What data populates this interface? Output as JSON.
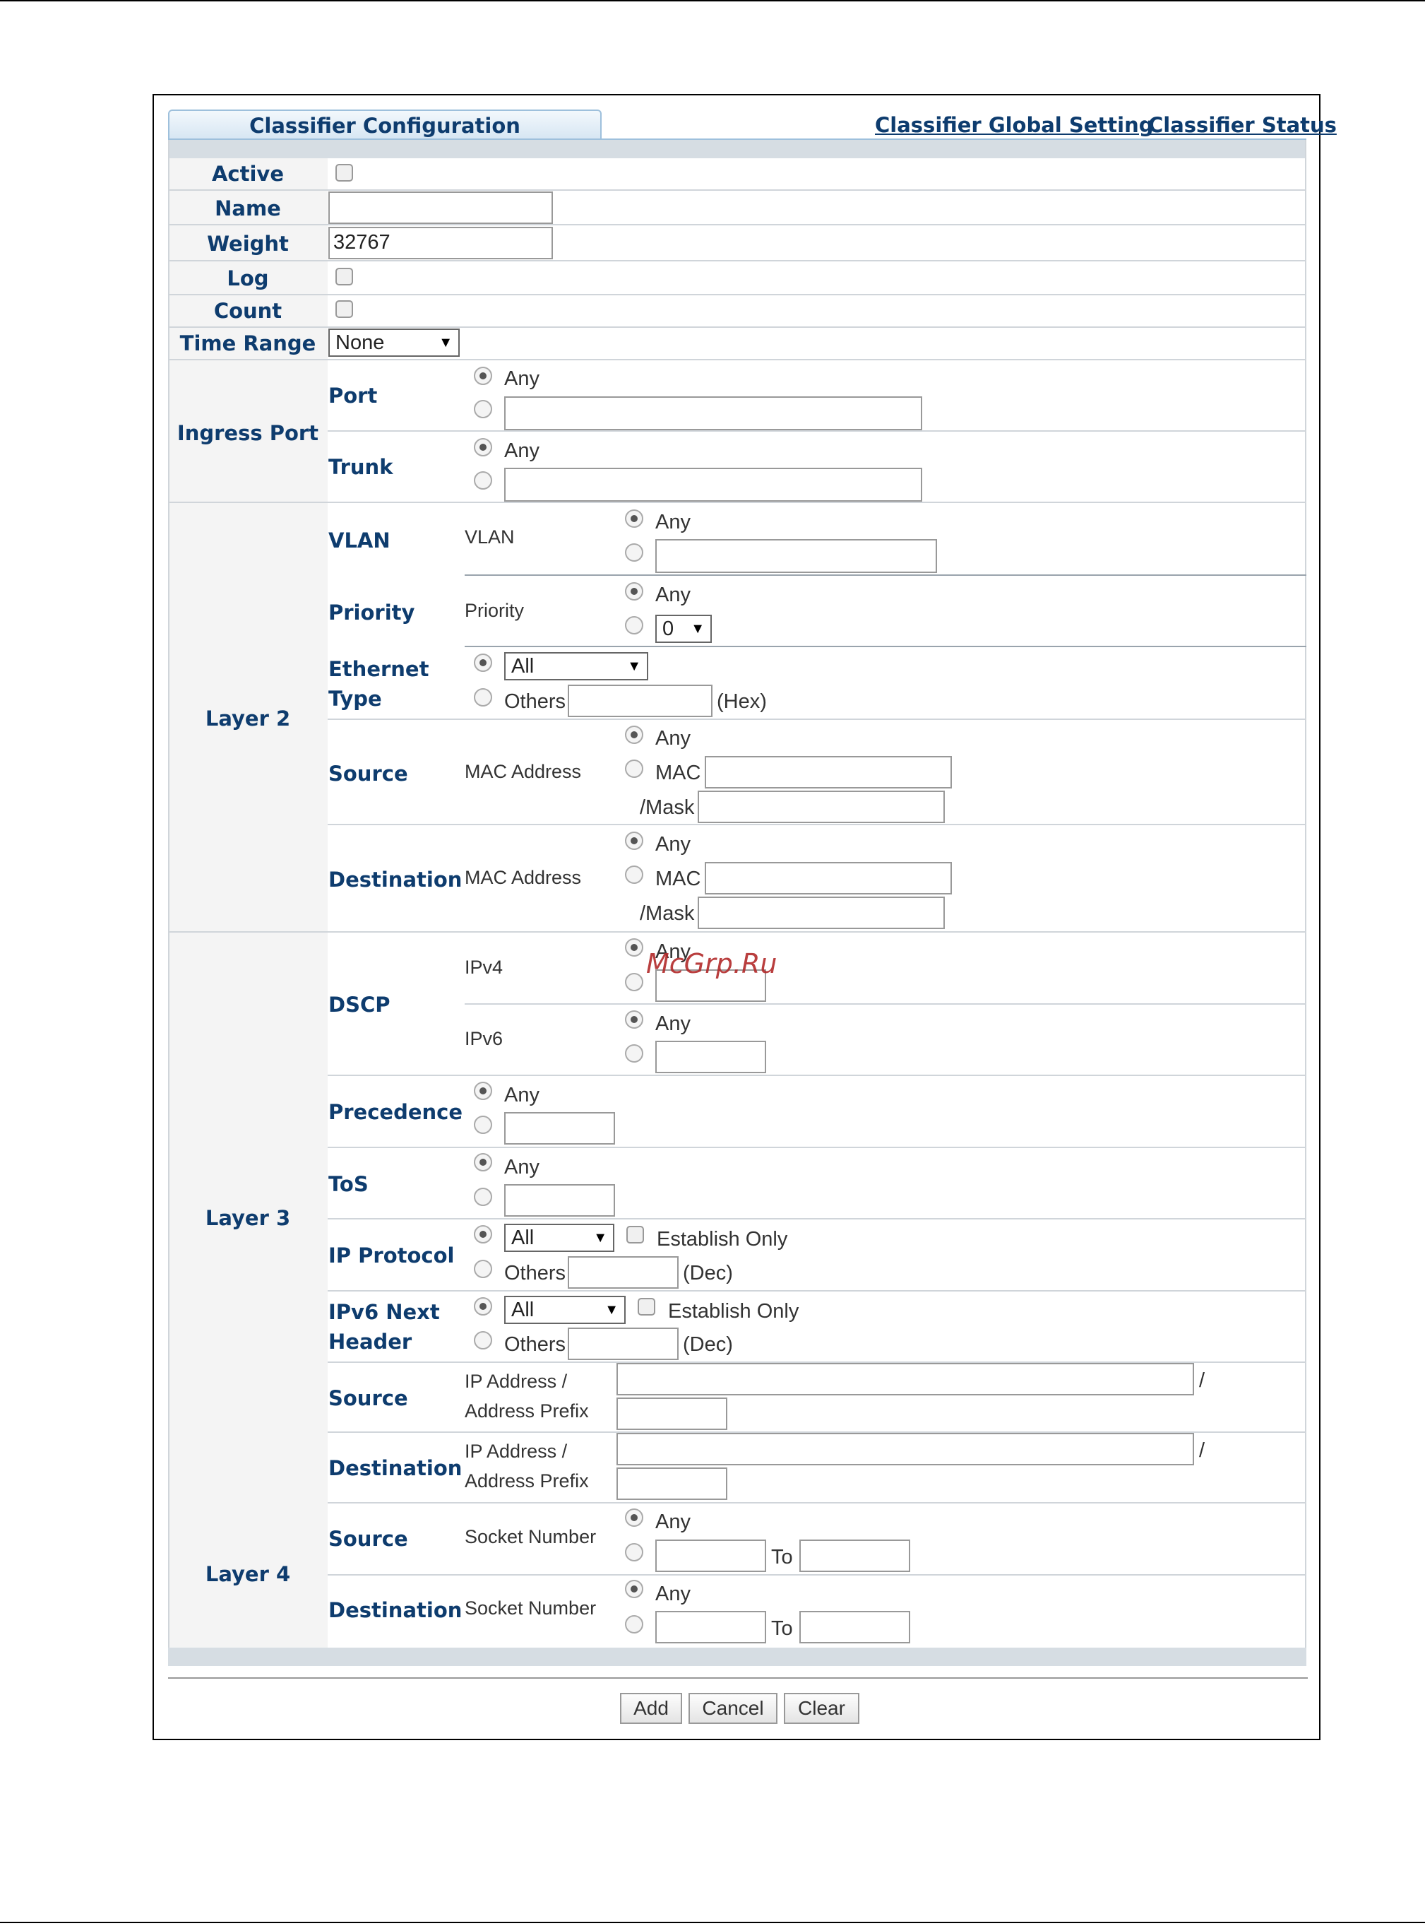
{
  "tabs": {
    "active": "Classifier Configuration",
    "global_setting": "Classifier Global Setting",
    "status": "Classifier Status"
  },
  "basic": {
    "active_label": "Active",
    "name_label": "Name",
    "name_value": "",
    "weight_label": "Weight",
    "weight_value": "32767",
    "log_label": "Log",
    "count_label": "Count",
    "time_range_label": "Time Range",
    "time_range_value": "None"
  },
  "ingress": {
    "section": "Ingress Port",
    "port_label": "Port",
    "trunk_label": "Trunk",
    "any": "Any"
  },
  "layer2": {
    "section": "Layer 2",
    "vlan_label": "VLAN",
    "vlan_sub": "VLAN",
    "priority_label": "Priority",
    "priority_sub": "Priority",
    "priority_value": "0",
    "ethernet_label_1": "Ethernet",
    "ethernet_label_2": "Type",
    "ethernet_value": "All",
    "others": "Others",
    "hex": "(Hex)",
    "source_label": "Source",
    "destination_label": "Destination",
    "mac_address": "MAC Address",
    "mac": "MAC",
    "mask": "/Mask",
    "any": "Any"
  },
  "layer3": {
    "section": "Layer 3",
    "dscp_label": "DSCP",
    "ipv4": "IPv4",
    "ipv6": "IPv6",
    "precedence_label": "Precedence",
    "tos_label": "ToS",
    "ip_protocol_label": "IP Protocol",
    "ip_protocol_value": "All",
    "ipv6_next_1": "IPv6 Next",
    "ipv6_next_2": "Header",
    "ipv6_next_value": "All",
    "establish_only": "Establish Only",
    "others": "Others",
    "dec": "(Dec)",
    "source_label": "Source",
    "destination_label": "Destination",
    "ip_address": "IP Address /",
    "address_prefix": "Address Prefix",
    "slash": "/",
    "any": "Any"
  },
  "layer4": {
    "section": "Layer 4",
    "source_label": "Source",
    "destination_label": "Destination",
    "socket_number": "Socket Number",
    "to": "To",
    "any": "Any"
  },
  "buttons": {
    "add": "Add",
    "cancel": "Cancel",
    "clear": "Clear"
  },
  "watermark": "McGrp.Ru"
}
